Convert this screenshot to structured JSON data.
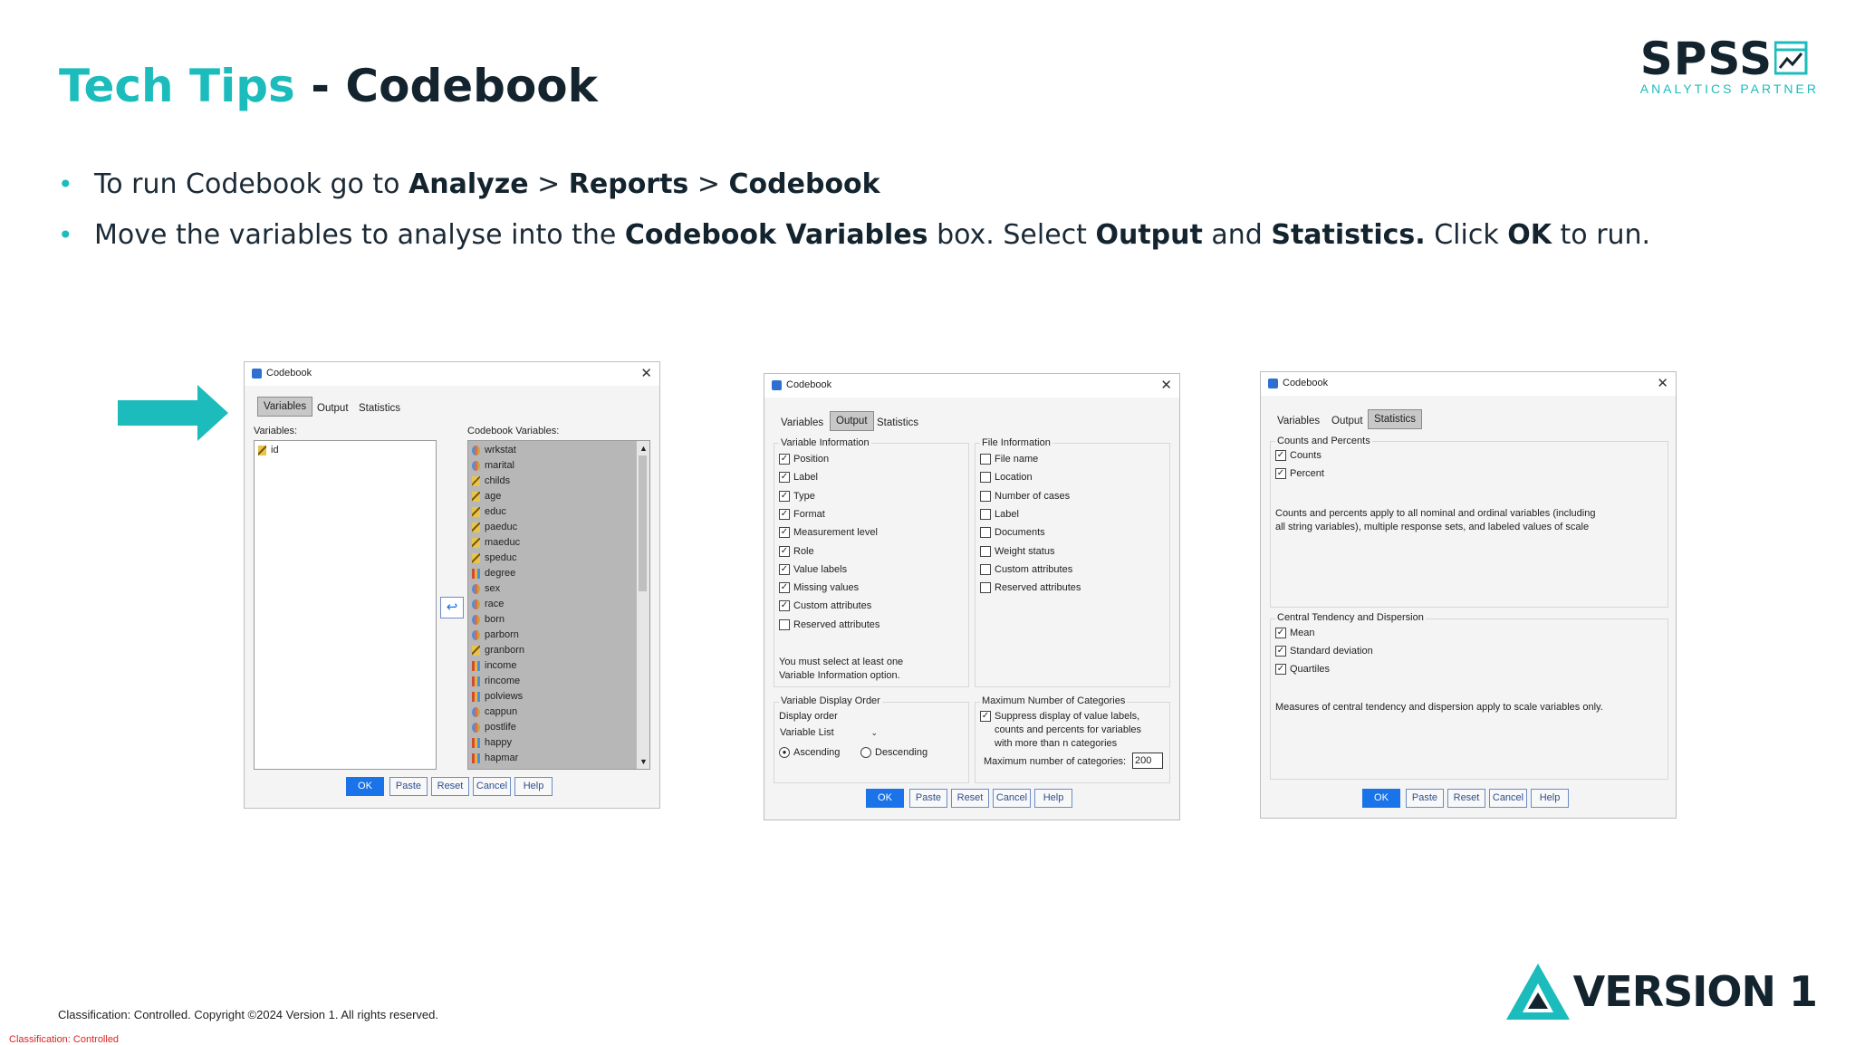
{
  "title": {
    "part1": "Tech Tips",
    "sep": " - ",
    "part2": "Codebook"
  },
  "logo": {
    "main": "SPSS",
    "sub": "ANALYTICS PARTNER"
  },
  "bullets": [
    {
      "pre": "To run Codebook go to ",
      "b1": "Analyze",
      "m1": " > ",
      "b2": "Reports",
      "m2": " > ",
      "b3": "Codebook"
    },
    {
      "pre": "Move the variables to analyse into the ",
      "b1": "Codebook Variables",
      "m1": " box. Select ",
      "b2": "Output",
      "m2": " and ",
      "b3": "Statistics.",
      "m3": " Click ",
      "b4": "OK",
      "post": " to run."
    }
  ],
  "dialog1": {
    "title": "Codebook",
    "tabs": [
      "Variables",
      "Output",
      "Statistics"
    ],
    "variables_label": "Variables:",
    "codebook_label": "Codebook Variables:",
    "left_vars": [
      {
        "name": "id",
        "kind": "scale"
      }
    ],
    "right_vars": [
      {
        "name": "wrkstat",
        "kind": "nom"
      },
      {
        "name": "marital",
        "kind": "nom"
      },
      {
        "name": "childs",
        "kind": "scale"
      },
      {
        "name": "age",
        "kind": "scale"
      },
      {
        "name": "educ",
        "kind": "scale"
      },
      {
        "name": "paeduc",
        "kind": "scale"
      },
      {
        "name": "maeduc",
        "kind": "scale"
      },
      {
        "name": "speduc",
        "kind": "scale"
      },
      {
        "name": "degree",
        "kind": "ord"
      },
      {
        "name": "sex",
        "kind": "nom"
      },
      {
        "name": "race",
        "kind": "nom"
      },
      {
        "name": "born",
        "kind": "nom"
      },
      {
        "name": "parborn",
        "kind": "nom"
      },
      {
        "name": "granborn",
        "kind": "scale"
      },
      {
        "name": "income",
        "kind": "ord"
      },
      {
        "name": "rincome",
        "kind": "ord"
      },
      {
        "name": "polviews",
        "kind": "ord"
      },
      {
        "name": "cappun",
        "kind": "nom"
      },
      {
        "name": "postlife",
        "kind": "nom"
      },
      {
        "name": "happy",
        "kind": "ord"
      },
      {
        "name": "hapmar",
        "kind": "ord"
      }
    ],
    "buttons": [
      "OK",
      "Paste",
      "Reset",
      "Cancel",
      "Help"
    ]
  },
  "dialog2": {
    "title": "Codebook",
    "tabs": [
      "Variables",
      "Output",
      "Statistics"
    ],
    "varinfo_title": "Variable Information",
    "varinfo": [
      {
        "label": "Position",
        "checked": true
      },
      {
        "label": "Label",
        "checked": true
      },
      {
        "label": "Type",
        "checked": true
      },
      {
        "label": "Format",
        "checked": true
      },
      {
        "label": "Measurement level",
        "checked": true
      },
      {
        "label": "Role",
        "checked": true
      },
      {
        "label": "Value labels",
        "checked": true
      },
      {
        "label": "Missing values",
        "checked": true
      },
      {
        "label": "Custom attributes",
        "checked": true
      },
      {
        "label": "Reserved attributes",
        "checked": false
      }
    ],
    "varinfo_note1": "You must select at least one",
    "varinfo_note2": "Variable Information option.",
    "fileinfo_title": "File Information",
    "fileinfo": [
      {
        "label": "File name",
        "checked": false
      },
      {
        "label": "Location",
        "checked": false
      },
      {
        "label": "Number of cases",
        "checked": false
      },
      {
        "label": "Label",
        "checked": false
      },
      {
        "label": "Documents",
        "checked": false
      },
      {
        "label": "Weight status",
        "checked": false
      },
      {
        "label": "Custom attributes",
        "checked": false
      },
      {
        "label": "Reserved attributes",
        "checked": false
      }
    ],
    "order_title": "Variable Display Order",
    "order_label": "Display order",
    "order_value": "Variable List",
    "asc": "Ascending",
    "desc": "Descending",
    "max_title": "Maximum Number of Categories",
    "suppress_l1": "Suppress display of value labels,",
    "suppress_l2": "counts and percents for variables",
    "suppress_l3": "with more than n categories",
    "max_label": "Maximum number of categories:",
    "max_value": "200",
    "buttons": [
      "OK",
      "Paste",
      "Reset",
      "Cancel",
      "Help"
    ]
  },
  "dialog3": {
    "title": "Codebook",
    "tabs": [
      "Variables",
      "Output",
      "Statistics"
    ],
    "cp_title": "Counts and Percents",
    "cp": [
      {
        "label": "Counts",
        "checked": true
      },
      {
        "label": "Percent",
        "checked": true
      }
    ],
    "cp_note1": "Counts and percents apply to all nominal and ordinal variables (including",
    "cp_note2": "all string variables), multiple response sets, and labeled values of scale",
    "ct_title": "Central Tendency and Dispersion",
    "ct": [
      {
        "label": "Mean",
        "checked": true
      },
      {
        "label": "Standard deviation",
        "checked": true
      },
      {
        "label": "Quartiles",
        "checked": true
      }
    ],
    "ct_note": "Measures of central tendency and dispersion apply to scale variables only.",
    "buttons": [
      "OK",
      "Paste",
      "Reset",
      "Cancel",
      "Help"
    ]
  },
  "footer": {
    "copyright": "Classification: Controlled. Copyright ©2024 Version 1. All rights reserved.",
    "classification": "Classification: Controlled",
    "brand": "VERSION 1"
  },
  "colors": {
    "accent": "#1cbcbc",
    "dark": "#13242f",
    "ok": "#1a73e8"
  }
}
